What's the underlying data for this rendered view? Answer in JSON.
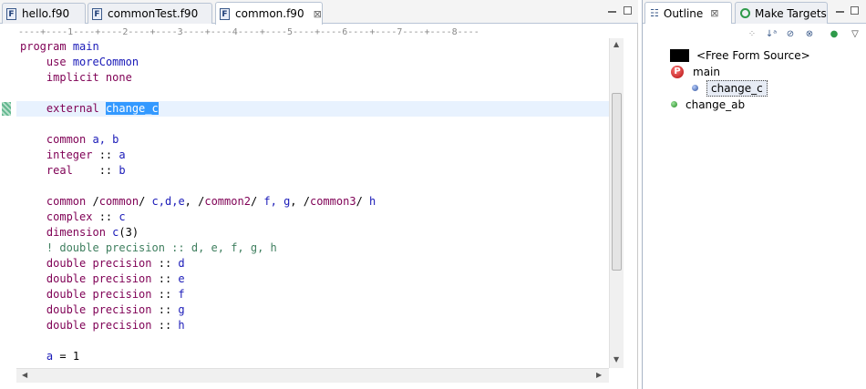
{
  "editor_tabs": [
    {
      "label": "hello.f90",
      "icon": "fortran-file-icon"
    },
    {
      "label": "commonTest.f90",
      "icon": "fortran-file-icon"
    },
    {
      "label": "common.f90",
      "icon": "fortran-file-icon",
      "active": true,
      "close": "⊠"
    }
  ],
  "ruler": "----+----1----+----2----+----3----+----4----+----5----+----6----+----7----+----8----",
  "code": {
    "l1_kw": "program",
    "l1_id": "main",
    "l2_kw": "use",
    "l2_id": "moreCommon",
    "l3_kw": "implicit none",
    "l4_kw": "external",
    "l4_sel": "change_c",
    "l5_kw": "common",
    "l5_rest": "a, b",
    "l6_kw": "integer",
    "l6_op": " :: ",
    "l6_id": "a",
    "l7_kw": "real",
    "l7_op": "    :: ",
    "l7_id": "b",
    "l8_kw": "common",
    "l8_p1": "/",
    "l8_i1": "common",
    "l8_p2": "/ ",
    "l8_i2": "c,d,e",
    "l8_p3": ", /",
    "l8_i3": "common2",
    "l8_p4": "/ ",
    "l8_i4": "f, g",
    "l8_p5": ", /",
    "l8_i5": "common3",
    "l8_p6": "/ ",
    "l8_i6": "h",
    "l9_kw": "complex",
    "l9_op": " :: ",
    "l9_id": "c",
    "l10_kw": "dimension",
    "l10_id": "c",
    "l10_rest": "(3)",
    "l11_cm": "! double precision :: d, e, f, g, h",
    "l12_kw": "double precision",
    "l12_op": " :: ",
    "l12_id": "d",
    "l13_kw": "double precision",
    "l13_op": " :: ",
    "l13_id": "e",
    "l14_kw": "double precision",
    "l14_op": " :: ",
    "l14_id": "f",
    "l15_kw": "double precision",
    "l15_op": " :: ",
    "l15_id": "g",
    "l16_kw": "double precision",
    "l16_op": " :: ",
    "l16_id": "h",
    "l17_id": "a",
    "l17_rest": " = 1"
  },
  "outline_tabs": [
    {
      "label": "Outline",
      "icon": "outline-icon",
      "close": "⊠",
      "active": true
    },
    {
      "label": "Make Targets",
      "icon": "make-targets-icon"
    }
  ],
  "outline_tree": {
    "source": "<Free Form Source>",
    "main": "main",
    "change_c": "change_c",
    "change_ab": "change_ab",
    "program_badge": "P"
  },
  "colors": {
    "keyword": "#7f0055",
    "identifier": "#1a1ab8",
    "comment": "#3f7f5f",
    "selection": "#3399ff"
  }
}
